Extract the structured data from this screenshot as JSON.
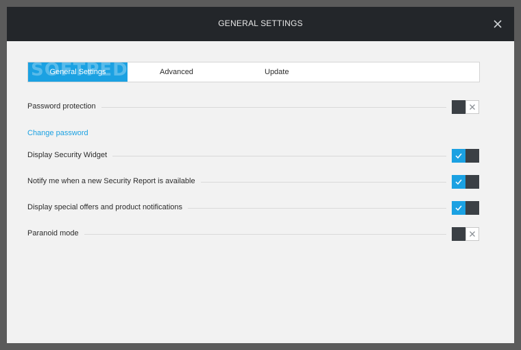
{
  "window": {
    "title": "GENERAL SETTINGS"
  },
  "tabs": [
    {
      "label": "General Settings",
      "active": true,
      "watermark": "SOFTPEDIA"
    },
    {
      "label": "Advanced",
      "active": false
    },
    {
      "label": "Update",
      "active": false
    }
  ],
  "settings": {
    "password_protection": {
      "label": "Password protection",
      "state": "off"
    },
    "change_password_link": "Change password",
    "security_widget": {
      "label": "Display Security Widget",
      "state": "on"
    },
    "security_report": {
      "label": "Notify me when a new Security Report is available",
      "state": "on"
    },
    "special_offers": {
      "label": "Display special offers and product notifications",
      "state": "on"
    },
    "paranoid_mode": {
      "label": "Paranoid mode",
      "state": "off"
    }
  },
  "icons": {
    "close": "close-icon",
    "check": "check-icon",
    "x": "x-icon"
  },
  "colors": {
    "accent": "#1ba1e2",
    "titlebar": "#23262a",
    "toggle_dark": "#3b4045"
  }
}
